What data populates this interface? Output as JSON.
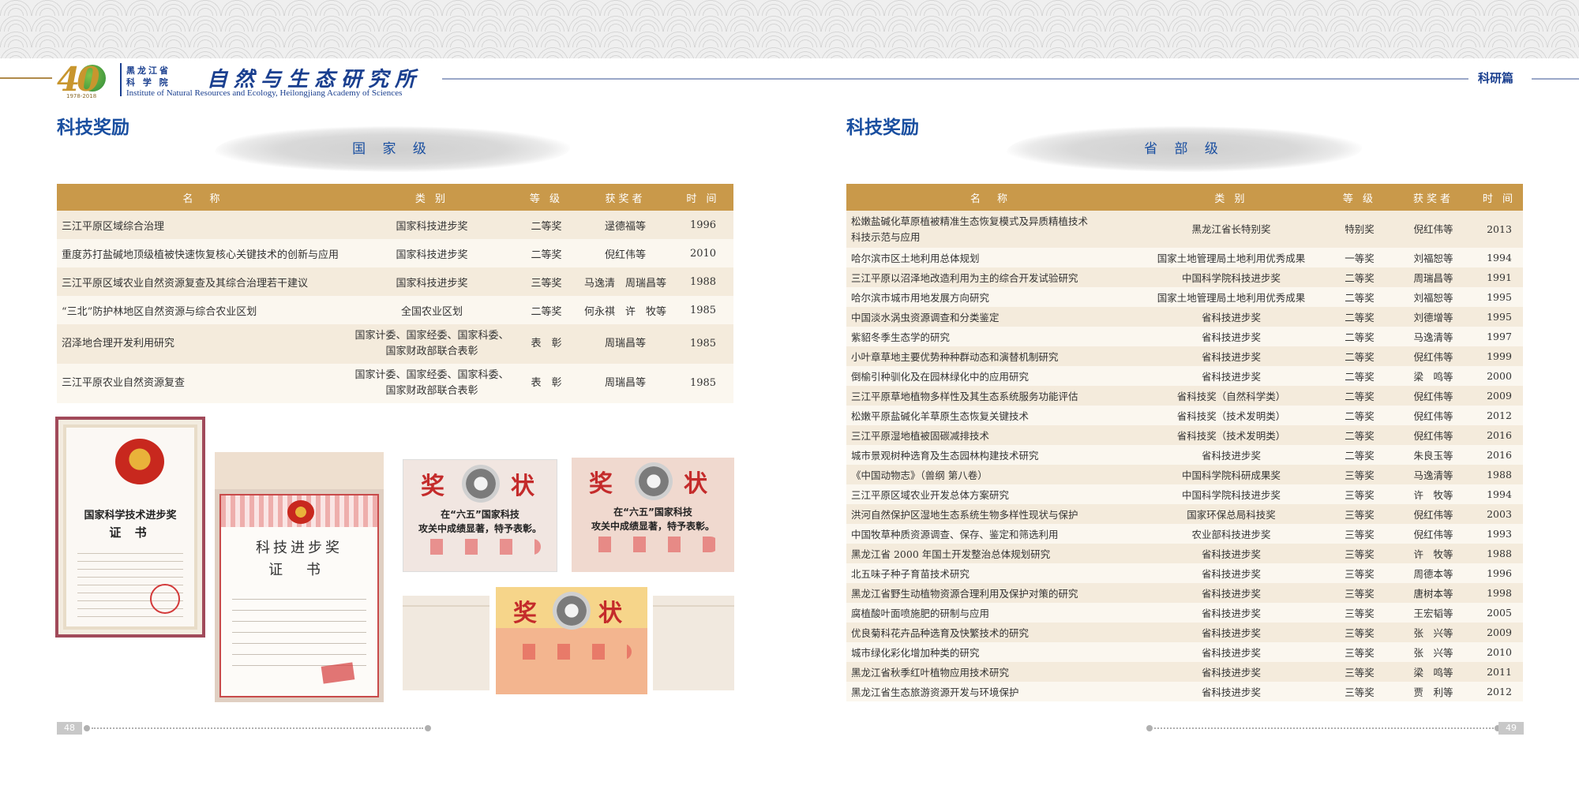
{
  "header": {
    "logo_number": "40",
    "logo_years": "1978-2018",
    "inst_cn_small_1": "黑龙江省",
    "inst_cn_small_2": "科 学 院",
    "inst_cn_large": "自然与生态研究所",
    "inst_en": "Institute of Natural Resources and Ecology, Heilongjiang Academy of Sciences",
    "section_tag": "科研篇"
  },
  "left": {
    "title": "科技奖励",
    "level": "国 家 级",
    "page_number": "48",
    "columns": [
      "名　称",
      "类 别",
      "等 级",
      "获奖者",
      "时 间"
    ],
    "rows": [
      {
        "name": "三江平原区域综合治理",
        "category": "国家科技进步奖",
        "grade": "二等奖",
        "winner": "逯德福等",
        "year": "1996"
      },
      {
        "name": "重度苏打盐碱地顶级植被快速恢复核心关键技术的创新与应用",
        "category": "国家科技进步奖",
        "grade": "二等奖",
        "winner": "倪红伟等",
        "year": "2010"
      },
      {
        "name": "三江平原区域农业自然资源复查及其综合治理若干建议",
        "category": "国家科技进步奖",
        "grade": "三等奖",
        "winner": "马逸清　周瑞昌等",
        "year": "1988"
      },
      {
        "name": "“三北”防护林地区自然资源与综合农业区划",
        "category": "全国农业区划",
        "grade": "二等奖",
        "winner": "何永祺　许　牧等",
        "year": "1985"
      },
      {
        "name": "沼泽地合理开发利用研究",
        "category_line1": "国家计委、国家经委、国家科委、",
        "category_line2": "国家财政部联合表彰",
        "grade": "表　彰",
        "winner": "周瑞昌等",
        "year": "1985"
      },
      {
        "name": "三江平原农业自然资源复查",
        "category_line1": "国家计委、国家经委、国家科委、",
        "category_line2": "国家财政部联合表彰",
        "grade": "表　彰",
        "winner": "周瑞昌等",
        "year": "1985"
      }
    ],
    "cert1": {
      "line1": "国家科学技术进步奖",
      "line2": "证 书"
    },
    "cert2": {
      "line1": "科技进步奖",
      "line2": "证 书"
    },
    "boards": {
      "big_left": "奖",
      "big_right": "状",
      "board_line1": "在“六五”国家科技",
      "board_line2": "攻关中成绩显著，特予表彰。"
    }
  },
  "right": {
    "title": "科技奖励",
    "level": "省 部 级",
    "page_number": "49",
    "columns": [
      "名　称",
      "类 别",
      "等 级",
      "获奖者",
      "时 间"
    ],
    "rows": [
      {
        "name_line1": "松嫩盐碱化草原植被精准生态恢复模式及异质精植技术",
        "name_line2": "科技示范与应用",
        "category": "黑龙江省长特别奖",
        "grade": "特别奖",
        "winner": "倪红伟等",
        "year": "2013"
      },
      {
        "name": "哈尔滨市区土地利用总体规划",
        "category": "国家土地管理局土地利用优秀成果",
        "grade": "一等奖",
        "winner": "刘福恕等",
        "year": "1994"
      },
      {
        "name": "三江平原以沼泽地改造利用为主的综合开发试验研究",
        "category": "中国科学院科技进步奖",
        "grade": "二等奖",
        "winner": "周瑞昌等",
        "year": "1991"
      },
      {
        "name": "哈尔滨市城市用地发展方向研究",
        "category": "国家土地管理局土地利用优秀成果",
        "grade": "二等奖",
        "winner": "刘福恕等",
        "year": "1995"
      },
      {
        "name": "中国淡水涡虫资源调查和分类鉴定",
        "category": "省科技进步奖",
        "grade": "二等奖",
        "winner": "刘德增等",
        "year": "1995"
      },
      {
        "name": "紫貂冬季生态学的研究",
        "category": "省科技进步奖",
        "grade": "二等奖",
        "winner": "马逸清等",
        "year": "1997"
      },
      {
        "name": "小叶章草地主要优势种种群动态和演替机制研究",
        "category": "省科技进步奖",
        "grade": "二等奖",
        "winner": "倪红伟等",
        "year": "1999"
      },
      {
        "name": "倒榆引种驯化及在园林绿化中的应用研究",
        "category": "省科技进步奖",
        "grade": "二等奖",
        "winner": "梁　鸣等",
        "year": "2000"
      },
      {
        "name": "三江平原草地植物多样性及其生态系统服务功能评估",
        "category": "省科技奖（自然科学类）",
        "grade": "二等奖",
        "winner": "倪红伟等",
        "year": "2009"
      },
      {
        "name": "松嫩平原盐碱化羊草原生态恢复关键技术",
        "category": "省科技奖（技术发明类）",
        "grade": "二等奖",
        "winner": "倪红伟等",
        "year": "2012"
      },
      {
        "name": "三江平原湿地植被固碳减排技术",
        "category": "省科技奖（技术发明类）",
        "grade": "二等奖",
        "winner": "倪红伟等",
        "year": "2016"
      },
      {
        "name": "城市景观树种选育及生态园林构建技术研究",
        "category": "省科技进步奖",
        "grade": "二等奖",
        "winner": "朱良玉等",
        "year": "2016"
      },
      {
        "name": "《中国动物志》（兽纲 第八卷）",
        "category": "中国科学院科研成果奖",
        "grade": "三等奖",
        "winner": "马逸清等",
        "year": "1988"
      },
      {
        "name": "三江平原区域农业开发总体方案研究",
        "category": "中国科学院科技进步奖",
        "grade": "三等奖",
        "winner": "许　牧等",
        "year": "1994"
      },
      {
        "name": "洪河自然保护区湿地生态系统生物多样性现状与保护",
        "category": "国家环保总局科技奖",
        "grade": "三等奖",
        "winner": "倪红伟等",
        "year": "2003"
      },
      {
        "name": "中国牧草种质资源调查、保存、鉴定和筛选利用",
        "category": "农业部科技进步奖",
        "grade": "三等奖",
        "winner": "倪红伟等",
        "year": "1993"
      },
      {
        "name": "黑龙江省 2000 年国土开发整治总体规划研究",
        "category": "省科技进步奖",
        "grade": "三等奖",
        "winner": "许　牧等",
        "year": "1988"
      },
      {
        "name": "北五味子种子育苗技术研究",
        "category": "省科技进步奖",
        "grade": "三等奖",
        "winner": "周德本等",
        "year": "1996"
      },
      {
        "name": "黑龙江省野生动植物资源合理利用及保护对策的研究",
        "category": "省科技进步奖",
        "grade": "三等奖",
        "winner": "唐树本等",
        "year": "1998"
      },
      {
        "name": "腐植酸叶面喷施肥的研制与应用",
        "category": "省科技进步奖",
        "grade": "三等奖",
        "winner": "王宏韬等",
        "year": "2005"
      },
      {
        "name": "优良菊科花卉品种选育及快繁技术的研究",
        "category": "省科技进步奖",
        "grade": "三等奖",
        "winner": "张　兴等",
        "year": "2009"
      },
      {
        "name": "城市绿化彩化增加种类的研究",
        "category": "省科技进步奖",
        "grade": "三等奖",
        "winner": "张　兴等",
        "year": "2010"
      },
      {
        "name": "黑龙江省秋季红叶植物应用技术研究",
        "category": "省科技进步奖",
        "grade": "三等奖",
        "winner": "梁　鸣等",
        "year": "2011"
      },
      {
        "name": "黑龙江省生态旅游资源开发与环境保护",
        "category": "省科技进步奖",
        "grade": "三等奖",
        "winner": "贾　利等",
        "year": "2012"
      }
    ]
  },
  "colors": {
    "header_bg": "#c9994a",
    "row_odd": "#f4ebdc",
    "row_even": "#fbf7ef",
    "title_blue": "#1a4fa0"
  }
}
